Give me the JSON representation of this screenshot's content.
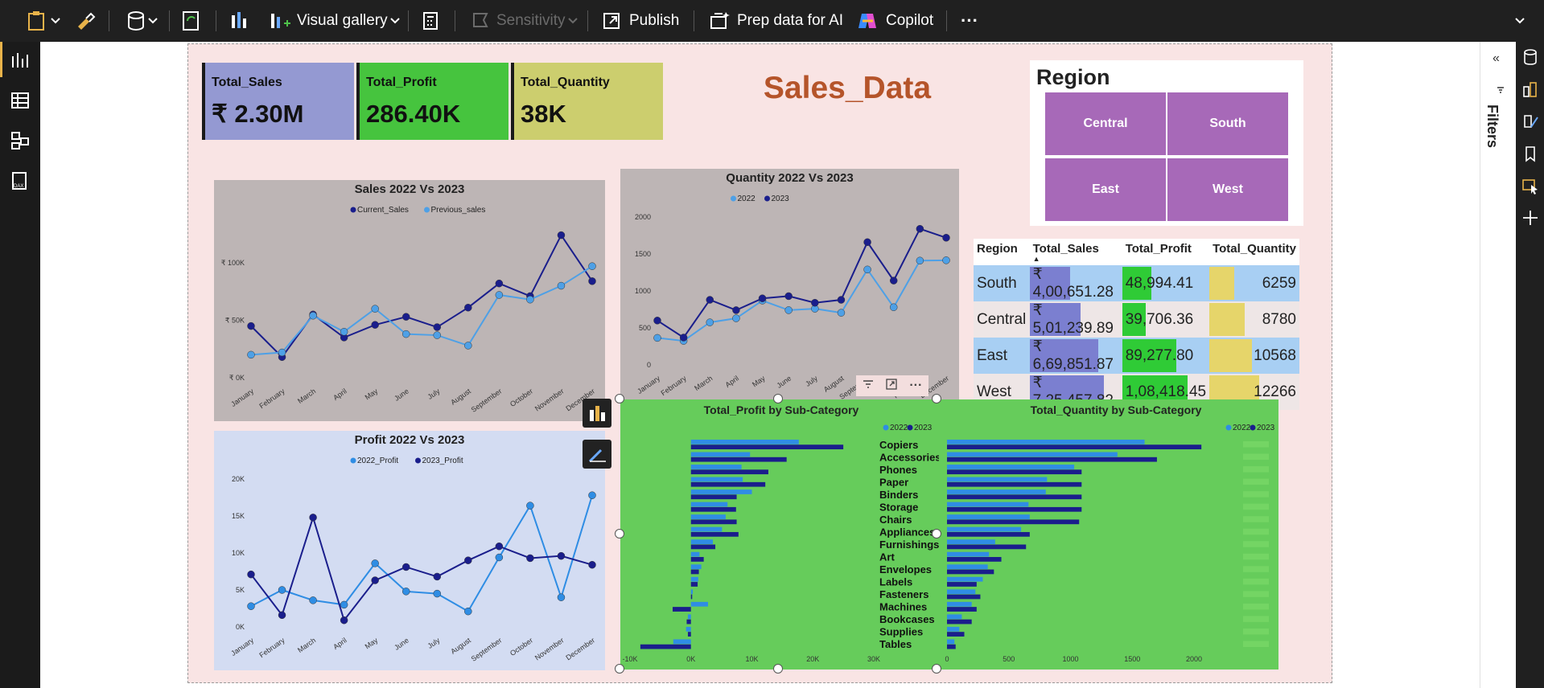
{
  "ribbon": {
    "visual_gallery": "Visual gallery",
    "sensitivity": "Sensitivity",
    "publish": "Publish",
    "prep_data": "Prep data for AI",
    "copilot": "Copilot",
    "more": "···"
  },
  "right_pane": {
    "filters": "Filters"
  },
  "report_title": "Sales_Data",
  "cards": [
    {
      "label": "Total_Sales",
      "value": "₹ 2.30M",
      "color": "#9499d2"
    },
    {
      "label": "Total_Profit",
      "value": "286.40K",
      "color": "#46c43e"
    },
    {
      "label": "Total_Quantity",
      "value": "38K",
      "color": "#ccce6e"
    }
  ],
  "slicer": {
    "title": "Region",
    "items": [
      "Central",
      "South",
      "East",
      "West"
    ]
  },
  "matrix": {
    "headers": [
      "Region",
      "Total_Sales",
      "Total_Profit",
      "Total_Quantity"
    ],
    "rows": [
      {
        "region": "South",
        "sales": "₹ 4,00,651.28",
        "profit": "48,994.41",
        "qty": "6259",
        "sales_v": 400651.28,
        "profit_v": 48994.41,
        "qty_v": 6259
      },
      {
        "region": "Central",
        "sales": "₹ 5,01,239.89",
        "profit": "39,706.36",
        "qty": "8780",
        "sales_v": 501239.89,
        "profit_v": 39706.36,
        "qty_v": 8780
      },
      {
        "region": "East",
        "sales": "₹ 6,69,851.87",
        "profit": "89,277.80",
        "qty": "10568",
        "sales_v": 669851.87,
        "profit_v": 89277.8,
        "qty_v": 10568
      },
      {
        "region": "West",
        "sales": "₹ 7,25,457.82",
        "profit": "1,08,418.45",
        "qty": "12266",
        "sales_v": 725457.82,
        "profit_v": 108418.45,
        "qty_v": 12266
      }
    ],
    "colors": {
      "sales": "#7b7fd0",
      "profit": "#2fcb36",
      "qty": "#e6d56a",
      "stripe": "#a8cff3"
    }
  },
  "chart_data": [
    {
      "id": "sales",
      "type": "line",
      "title": "Sales 2022 Vs 2023",
      "categories": [
        "January",
        "February",
        "March",
        "April",
        "May",
        "June",
        "July",
        "August",
        "September",
        "October",
        "November",
        "December"
      ],
      "series": [
        {
          "name": "Current_Sales",
          "color": "#1a1e8c",
          "values": [
            45,
            18,
            55,
            35,
            46,
            53,
            44,
            61,
            82,
            71,
            124,
            84
          ]
        },
        {
          "name": "Previous_sales",
          "color": "#4ea0e6",
          "values": [
            20,
            22,
            54,
            40,
            60,
            38,
            37,
            28,
            72,
            68,
            80,
            97
          ]
        }
      ],
      "yticks": [
        {
          "v": 0,
          "label": "₹ 0K"
        },
        {
          "v": 50,
          "label": "₹ 50K"
        },
        {
          "v": 100,
          "label": "₹ 100K"
        }
      ],
      "ylim": [
        0,
        130
      ],
      "legend": "top",
      "bg": "#bdb5b5"
    },
    {
      "id": "qty",
      "type": "line",
      "title": "Quantity 2022 Vs 2023",
      "categories": [
        "January",
        "February",
        "March",
        "April",
        "May",
        "June",
        "July",
        "August",
        "September",
        "October",
        "November",
        "December"
      ],
      "series": [
        {
          "name": "2022",
          "color": "#4ea0e6",
          "values": [
            365,
            325,
            575,
            630,
            870,
            740,
            760,
            705,
            1290,
            780,
            1410,
            1415
          ]
        },
        {
          "name": "2023",
          "color": "#1a1e8c",
          "values": [
            600,
            370,
            880,
            740,
            900,
            930,
            840,
            880,
            1660,
            1140,
            1840,
            1720
          ]
        }
      ],
      "yticks": [
        {
          "v": 0,
          "label": "0"
        },
        {
          "v": 500,
          "label": "500"
        },
        {
          "v": 1000,
          "label": "1000"
        },
        {
          "v": 1500,
          "label": "1500"
        },
        {
          "v": 2000,
          "label": "2000"
        }
      ],
      "ylim": [
        0,
        2000
      ],
      "legend": "top",
      "bg": "#bdb5b5"
    },
    {
      "id": "profit",
      "type": "line",
      "title": "Profit 2022 Vs 2023",
      "categories": [
        "January",
        "February",
        "March",
        "April",
        "May",
        "June",
        "July",
        "August",
        "September",
        "October",
        "November",
        "December"
      ],
      "series": [
        {
          "name": "2022_Profit",
          "color": "#2f8de4",
          "values": [
            2800,
            5000,
            3600,
            3000,
            8600,
            4800,
            4500,
            2100,
            9400,
            16400,
            4000,
            17800
          ]
        },
        {
          "name": "2023_Profit",
          "color": "#1a1e8c",
          "values": [
            7100,
            1600,
            14800,
            900,
            6300,
            8100,
            6800,
            9000,
            10900,
            9300,
            9600,
            8400
          ]
        }
      ],
      "yticks": [
        {
          "v": 0,
          "label": "0K"
        },
        {
          "v": 5000,
          "label": "5K"
        },
        {
          "v": 10000,
          "label": "10K"
        },
        {
          "v": 15000,
          "label": "15K"
        },
        {
          "v": 20000,
          "label": "20K"
        }
      ],
      "ylim": [
        0,
        20000
      ],
      "legend": "top",
      "bg": "#d3dcf2"
    },
    {
      "id": "profit_sub",
      "type": "bar",
      "orientation": "horizontal",
      "title": "Total_Profit by Sub-Category",
      "categories": [
        "Copiers",
        "Accessories",
        "Phones",
        "Paper",
        "Binders",
        "Storage",
        "Chairs",
        "Appliances",
        "Furnishings",
        "Art",
        "Envelopes",
        "Labels",
        "Fasteners",
        "Machines",
        "Bookcases",
        "Supplies",
        "Tables"
      ],
      "series": [
        {
          "name": "2022",
          "color": "#2f8de4",
          "values": [
            17700,
            9700,
            8300,
            8500,
            10000,
            6000,
            5700,
            5100,
            3600,
            1400,
            1700,
            1200,
            300,
            2800,
            -500,
            -800,
            -2900
          ]
        },
        {
          "name": "2023",
          "color": "#1a1e8c",
          "values": [
            25000,
            15700,
            12700,
            12200,
            7500,
            7400,
            7500,
            7800,
            4000,
            2100,
            1300,
            1100,
            200,
            -3000,
            -700,
            -500,
            -8300
          ]
        }
      ],
      "xticks": [
        {
          "v": -10000,
          "label": "-10K"
        },
        {
          "v": 0,
          "label": "0K"
        },
        {
          "v": 10000,
          "label": "10K"
        },
        {
          "v": 20000,
          "label": "20K"
        },
        {
          "v": 30000,
          "label": "30K"
        }
      ],
      "xlim": [
        -10000,
        30000
      ],
      "legend": "top-right",
      "bg": "#66cc5b"
    },
    {
      "id": "qty_sub",
      "type": "bar",
      "orientation": "horizontal",
      "title": "Total_Quantity by Sub-Category",
      "categories": [
        "Copiers",
        "Accessories",
        "Phones",
        "Paper",
        "Binders",
        "Storage",
        "Chairs",
        "Appliances",
        "Furnishings",
        "Art",
        "Envelopes",
        "Labels",
        "Fasteners",
        "Machines",
        "Bookcases",
        "Supplies",
        "Tables"
      ],
      "series": [
        {
          "name": "2022",
          "color": "#2f8de4",
          "values": [
            1600,
            1380,
            1030,
            810,
            800,
            660,
            670,
            600,
            390,
            340,
            330,
            290,
            230,
            200,
            120,
            100,
            60
          ]
        },
        {
          "name": "2023",
          "color": "#1a1e8c",
          "values": [
            2060,
            1700,
            1090,
            1090,
            1090,
            1090,
            1070,
            670,
            640,
            440,
            380,
            240,
            270,
            240,
            200,
            140,
            70
          ]
        }
      ],
      "xticks": [
        {
          "v": 0,
          "label": "0"
        },
        {
          "v": 500,
          "label": "500"
        },
        {
          "v": 1000,
          "label": "1000"
        },
        {
          "v": 1500,
          "label": "1500"
        },
        {
          "v": 2000,
          "label": "2000"
        }
      ],
      "xlim": [
        0,
        2150
      ],
      "legend": "top-right",
      "bg": "#66cc5b"
    }
  ]
}
